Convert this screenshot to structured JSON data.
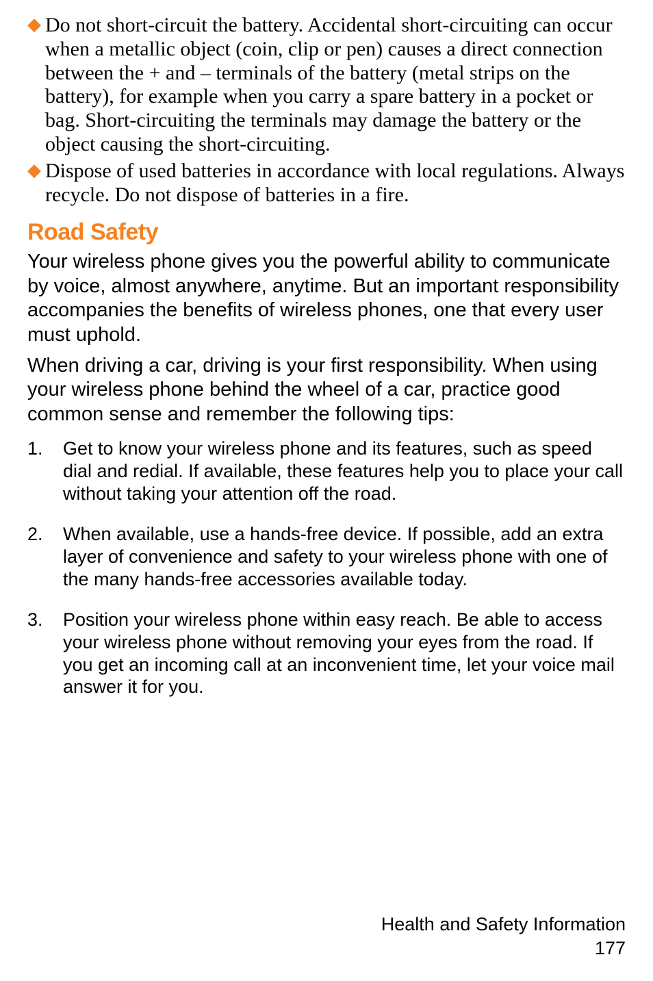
{
  "bullets": [
    {
      "text": "Do not short-circuit the battery. Accidental short-circuiting can occur when a metallic object (coin, clip or pen) causes a direct connection between the + and – terminals of the battery (metal strips on the battery), for example when you carry a spare battery in a pocket or bag. Short-circuiting the terminals may damage the battery or the object causing the short-circuiting."
    },
    {
      "text": "Dispose of used batteries in accordance with local regulations. Always recycle. Do not dispose of batteries in a fire."
    }
  ],
  "heading": "Road Safety",
  "paragraphs": [
    "Your wireless phone gives you the powerful ability to communicate by voice, almost anywhere, anytime. But an important responsibility accompanies the benefits of wireless phones, one that every user must uphold.",
    "When driving a car, driving is your first responsibility. When using your wireless phone behind the wheel of a car, practice good common sense and remember the following tips:"
  ],
  "numbered": [
    {
      "num": "1.",
      "text": "Get to know your wireless phone and its features, such as speed dial and redial. If available, these features help you to place your call without taking your attention off the road."
    },
    {
      "num": "2.",
      "text": "When available, use a hands-free device. If possible, add an extra layer of convenience and safety to your wireless phone with one of the many hands-free accessories available today."
    },
    {
      "num": "3.",
      "text": "Position your wireless phone within easy reach. Be able to access your wireless phone without removing your eyes from the road. If you get an incoming call at an inconvenient time, let your voice mail answer it for you."
    }
  ],
  "footer": {
    "section": "Health and Safety Information",
    "page": "177"
  }
}
